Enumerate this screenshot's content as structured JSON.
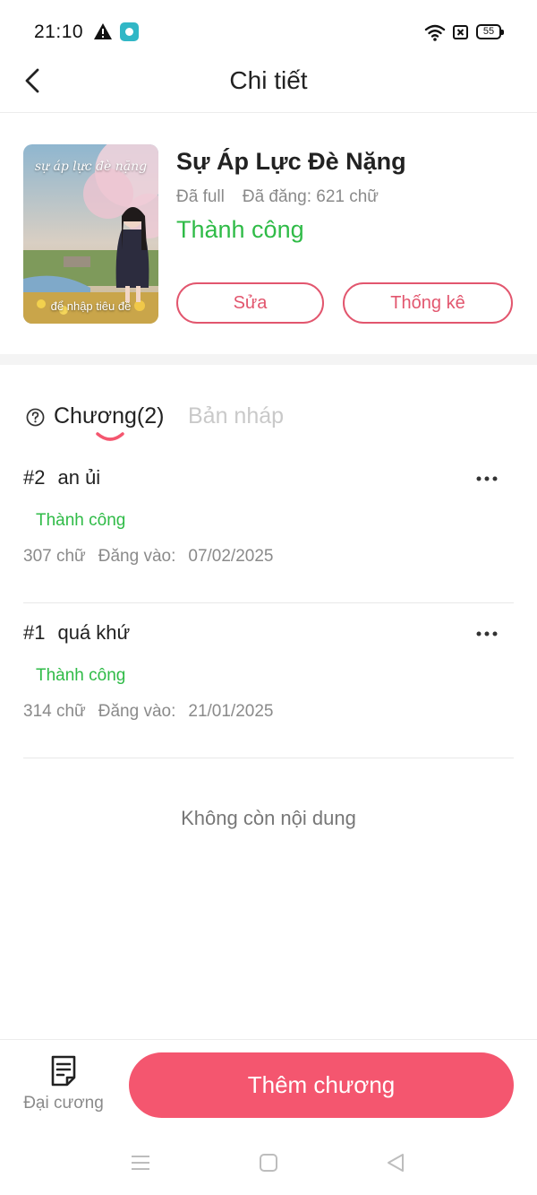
{
  "status_bar": {
    "time": "21:10",
    "battery": "55"
  },
  "header": {
    "title": "Chi tiết"
  },
  "book": {
    "cover_title": "sự áp lực đè nặng",
    "cover_caption": "để nhập tiêu đề",
    "title": "Sự Áp Lực Đè Nặng",
    "completion": "Đã full",
    "posted": "Đã đăng: 621 chữ",
    "status": "Thành công",
    "edit_label": "Sửa",
    "stats_label": "Thống kê"
  },
  "tabs": {
    "chapters": "Chương(2)",
    "drafts": "Bản nháp"
  },
  "chapters": [
    {
      "number": "#2",
      "title": "an ủi",
      "status": "Thành công",
      "words": "307 chữ",
      "posted_label": "Đăng vào:",
      "date": "07/02/2025"
    },
    {
      "number": "#1",
      "title": "quá khứ",
      "status": "Thành công",
      "words": "314 chữ",
      "posted_label": "Đăng vào:",
      "date": "21/01/2025"
    }
  ],
  "end_note": "Không còn nội dung",
  "bottom": {
    "outline_label": "Đại cương",
    "add_chapter_label": "Thêm chương"
  },
  "colors": {
    "accent": "#f4566f",
    "success": "#2fbb47",
    "muted": "#8a8a8a"
  },
  "icons": [
    "warning-icon",
    "app-notification-icon",
    "wifi-icon",
    "close-box-icon",
    "battery-icon",
    "back-icon",
    "help-icon",
    "more-icon",
    "outline-document-icon",
    "nav-menu-icon",
    "nav-home-icon",
    "nav-back-icon"
  ]
}
